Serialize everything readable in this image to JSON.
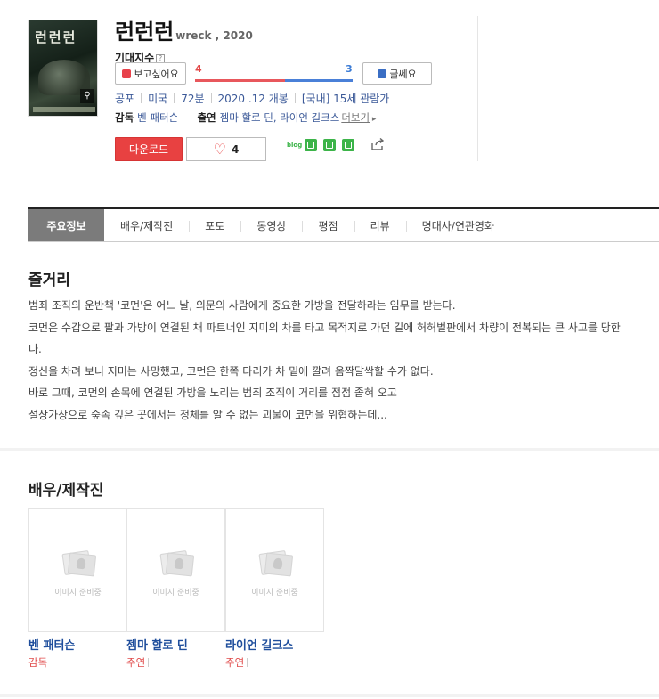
{
  "movie": {
    "title": "런런런",
    "subtitle": "wreck , 2020",
    "poster_title": "런런런",
    "expect_label": "기대지수",
    "expect_help": "?",
    "want_label": "보고싶어요",
    "not_label": "글쎄요",
    "want_count": "4",
    "not_count": "3",
    "want_ratio": 0.57,
    "meta": [
      "공포",
      "미국",
      "72분",
      "2020 .12 개봉",
      "[국내] 15세 관람가"
    ],
    "director_label": "감독",
    "director": "벤 패터슨",
    "cast_label": "출연",
    "cast": "젬마 할로 딘, 라이언 길크스",
    "more_label": "더보기",
    "download_label": "다운로드",
    "like_count": "4",
    "share_blog": "blog"
  },
  "tabs": [
    "주요정보",
    "배우/제작진",
    "포토",
    "동영상",
    "평점",
    "리뷰",
    "명대사/연관영화"
  ],
  "synopsis": {
    "title": "줄거리",
    "lines": [
      "범죄 조직의 운반책 '코먼'은 어느 날, 의문의 사람에게 중요한 가방을 전달하라는 임무를 받는다.",
      " 코먼은 수갑으로 팔과 가방이 연결된 채 파트너인 지미의 차를 타고 목적지로 가던 길에 허허벌판에서 차량이 전복되는 큰 사고를 당한다.",
      " 정신을 차려 보니 지미는 사망했고, 코먼은 한쪽 다리가 차 밑에 깔려 옴짝달싹할 수가 없다.",
      " 바로 그때, 코먼의 손목에 연결된 가방을 노리는 범죄 조직이 거리를 점점 좁혀 오고",
      " 설상가상으로 숲속 깊은 곳에서는 정체를 알 수 없는 괴물이 코먼을 위협하는데..."
    ]
  },
  "cast_section": {
    "title": "배우/제작진",
    "placeholder": "이미지 준비중",
    "people": [
      {
        "name": "벤 패터슨",
        "role": "감독"
      },
      {
        "name": "젬마 할로 딘",
        "role": "주연"
      },
      {
        "name": "라이언 길크스",
        "role": "주연"
      }
    ]
  },
  "colors": {
    "accent": "#e84141",
    "link": "#3b5998",
    "gauge_red": "#e8575c",
    "gauge_blue": "#4a80d8"
  }
}
